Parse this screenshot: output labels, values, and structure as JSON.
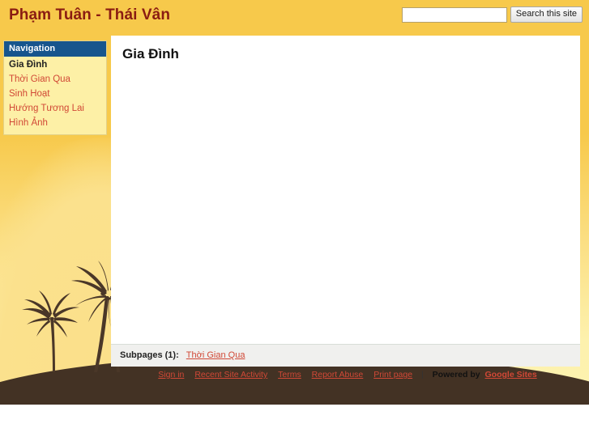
{
  "header": {
    "site_title": "Phạm Tuân - Thái Vân",
    "search": {
      "value": "",
      "placeholder": "",
      "button_label": "Search this site"
    }
  },
  "sidebar": {
    "nav_title": "Navigation",
    "items": [
      {
        "label": "Gia Đình",
        "selected": true
      },
      {
        "label": "Thời Gian Qua",
        "selected": false
      },
      {
        "label": "Sinh Hoạt",
        "selected": false
      },
      {
        "label": "Hướng Tương Lai",
        "selected": false
      },
      {
        "label": "Hình Ảnh",
        "selected": false
      }
    ]
  },
  "main": {
    "page_title": "Gia Đình",
    "page_body": "",
    "subpages": {
      "label": "Subpages (1):",
      "links": [
        "Thời Gian Qua"
      ]
    }
  },
  "footer": {
    "links": [
      "Sign in",
      "Recent Site Activity",
      "Terms",
      "Report Abuse",
      "Print page"
    ],
    "separator": "|",
    "powered_by": "Powered by",
    "brand": "Google Sites"
  },
  "colors": {
    "header_background": "#F7C94B",
    "title_text": "#8A1C12",
    "nav_header_background": "#17558D",
    "nav_background": "#FDF0A6",
    "link_red": "#D14836",
    "content_background": "#FFFFFF",
    "subpages_background": "#F0F0EE",
    "dune": "#433224"
  }
}
